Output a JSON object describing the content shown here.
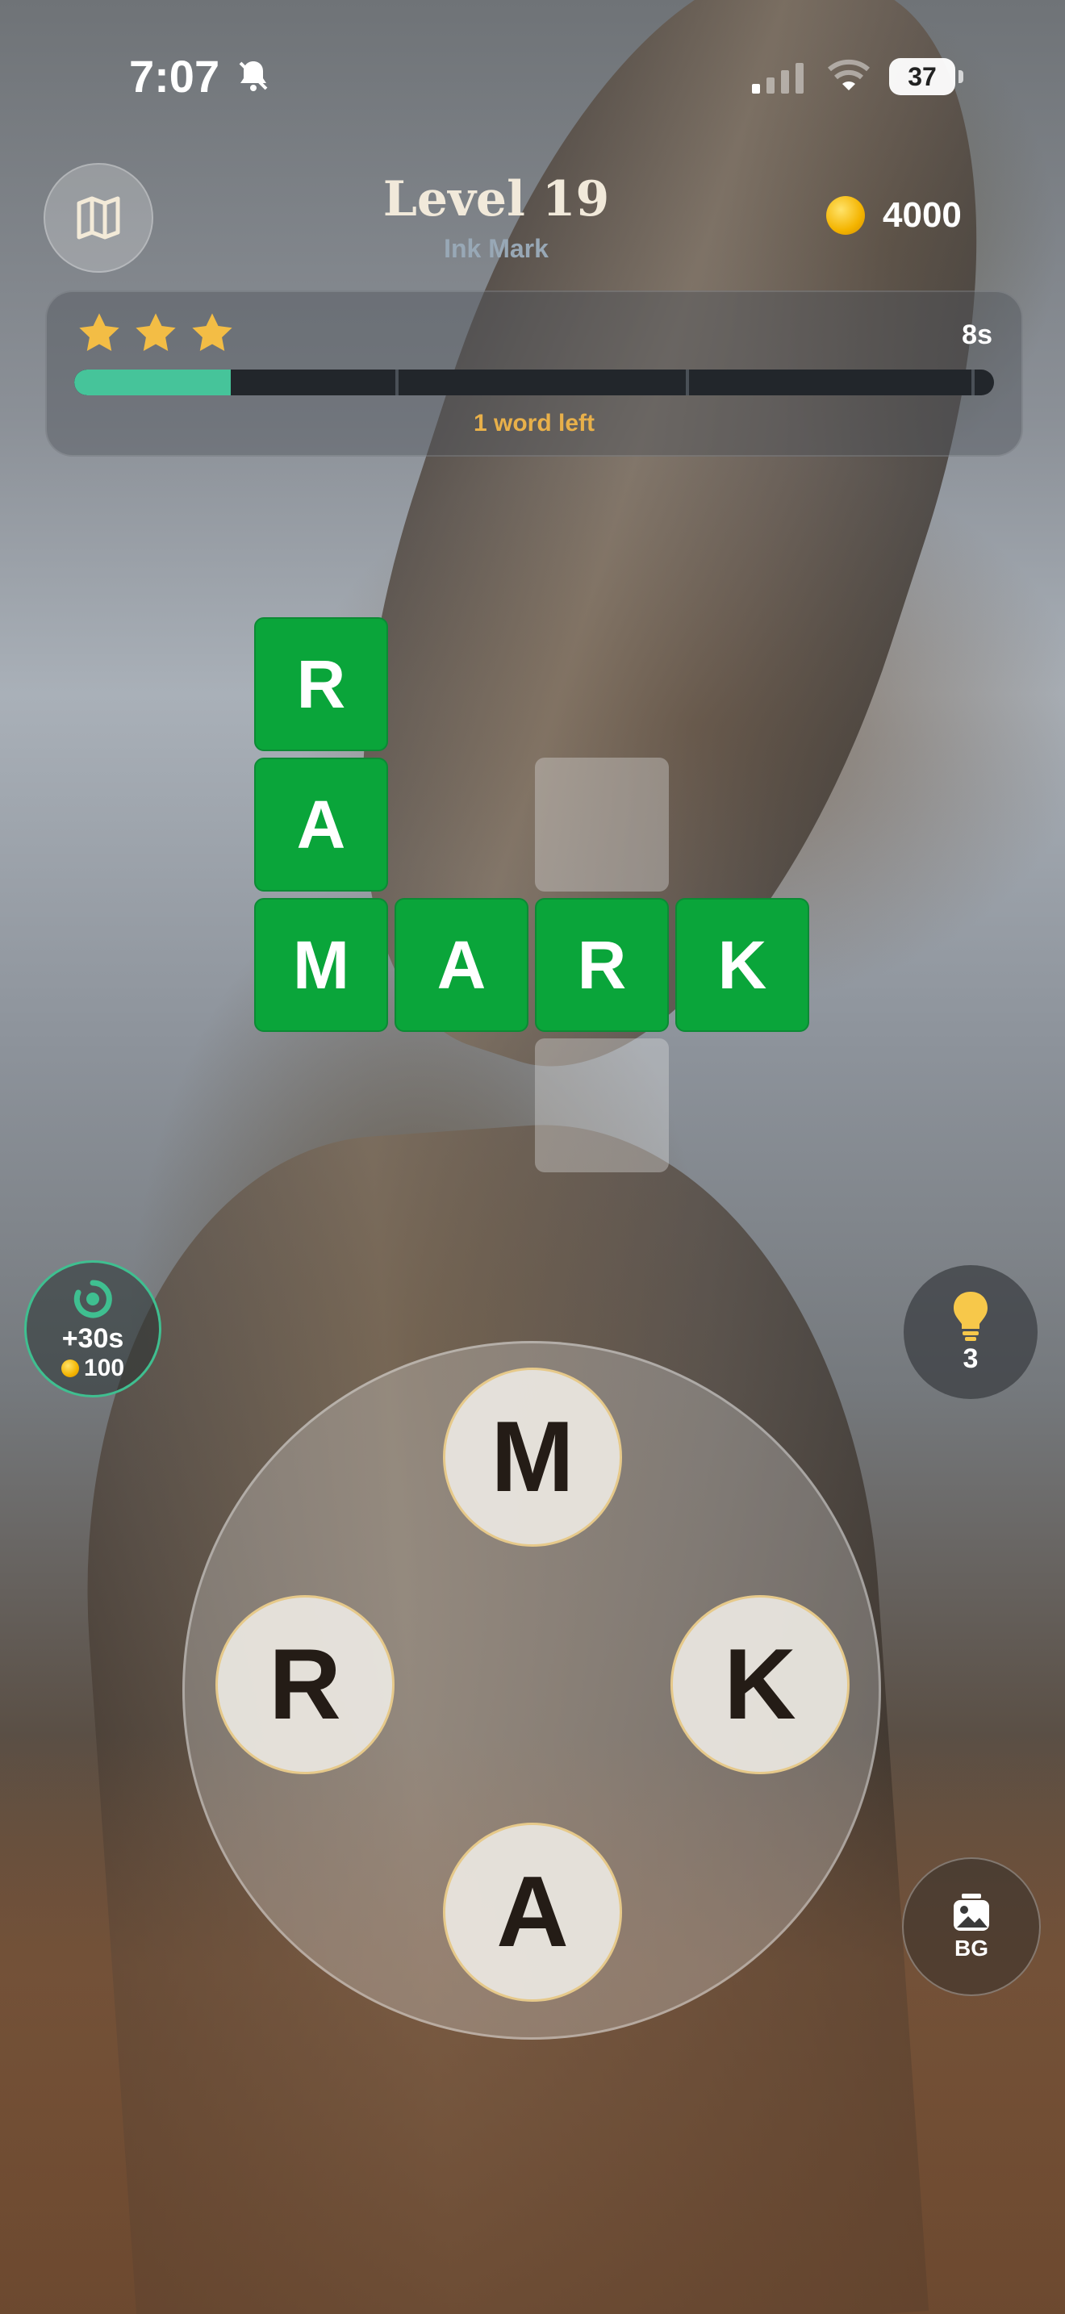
{
  "status_bar": {
    "time": "7:07",
    "battery": "37",
    "icons": [
      "bell-slash-icon",
      "cellular-signal-icon",
      "wifi-icon",
      "battery-icon"
    ]
  },
  "header": {
    "level_title": "Level 19",
    "level_subtitle": "Ink Mark",
    "coins": "4000",
    "icons": [
      "map-icon",
      "coin-icon"
    ]
  },
  "progress": {
    "stars": 3,
    "timer": "8s",
    "fill_fraction": 0.17,
    "segments": 4,
    "words_left": "1 word left"
  },
  "grid": {
    "tiles": [
      {
        "letter": "R",
        "state": "filled"
      },
      {
        "letter": "A",
        "state": "filled"
      },
      {
        "letter": "M",
        "state": "filled"
      },
      {
        "letter": "A",
        "state": "filled"
      },
      {
        "letter": "R",
        "state": "filled"
      },
      {
        "letter": "K",
        "state": "filled"
      },
      {
        "letter": "",
        "state": "empty"
      },
      {
        "letter": "",
        "state": "empty"
      }
    ]
  },
  "powerups": {
    "time_boost": {
      "label": "+30s",
      "cost": "100",
      "icon": "timer-refresh-icon"
    },
    "hint": {
      "count": "3",
      "icon": "lightbulb-icon"
    },
    "background": {
      "label": "BG",
      "icon": "image-icon"
    }
  },
  "wheel": {
    "letters": [
      "M",
      "R",
      "K",
      "A"
    ]
  },
  "colors": {
    "tile_green": "#0aa53a",
    "progress_fill": "#46c49a",
    "words_left": "#e8b04a",
    "star": "#f3bd45"
  }
}
